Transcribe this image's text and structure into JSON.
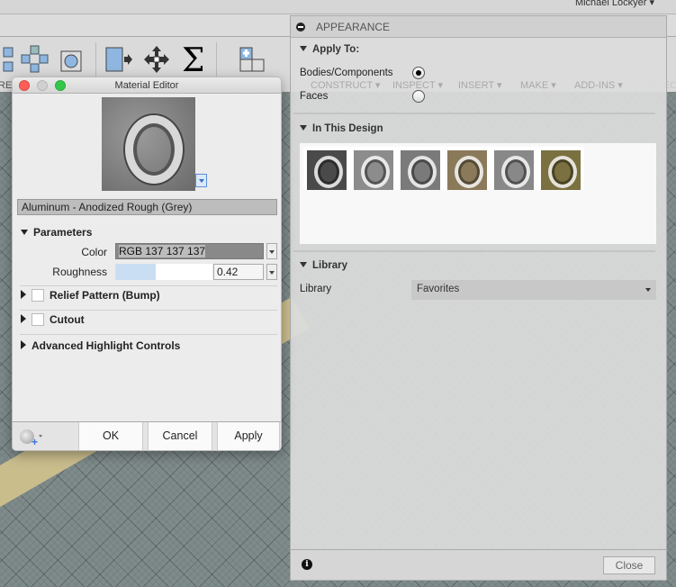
{
  "topbar": {
    "user": "Michael Lockyer ▾"
  },
  "toolbar": {
    "labels": [
      "REA",
      "CONSTRUCT ▾",
      "INSPECT ▾",
      "INSERT ▾",
      "MAKE ▾",
      "ADD-INS ▾",
      "SELECT"
    ]
  },
  "appearance": {
    "title": "APPEARANCE",
    "apply_to": {
      "header": "Apply To:",
      "options": [
        {
          "label": "Bodies/Components",
          "selected": true
        },
        {
          "label": "Faces",
          "selected": false
        }
      ]
    },
    "in_this_design": {
      "header": "In This Design",
      "thumbnails": [
        {
          "color": "#4a4a4a"
        },
        {
          "color": "#8c8c8c"
        },
        {
          "color": "#7a7a7a"
        },
        {
          "color": "#8a7a5a"
        },
        {
          "color": "#888888"
        },
        {
          "color": "#7a7040"
        }
      ]
    },
    "library": {
      "header": "Library",
      "label": "Library",
      "value": "Favorites"
    },
    "close_label": "Close",
    "info_icon": "i"
  },
  "material_editor": {
    "title": "Material Editor",
    "material_name": "Aluminum - Anodized Rough (Grey)",
    "parameters": {
      "header": "Parameters",
      "color_label": "Color",
      "color_value": "RGB 137 137 137",
      "roughness_label": "Roughness",
      "roughness_value": "0.42",
      "roughness_fraction": 0.42
    },
    "sections": [
      {
        "label": "Relief Pattern (Bump)",
        "checkbox": true,
        "checked": false
      },
      {
        "label": "Cutout",
        "checkbox": true,
        "checked": false
      },
      {
        "label": "Advanced Highlight Controls",
        "checkbox": false
      }
    ],
    "buttons": {
      "ok": "OK",
      "cancel": "Cancel",
      "apply": "Apply"
    }
  }
}
